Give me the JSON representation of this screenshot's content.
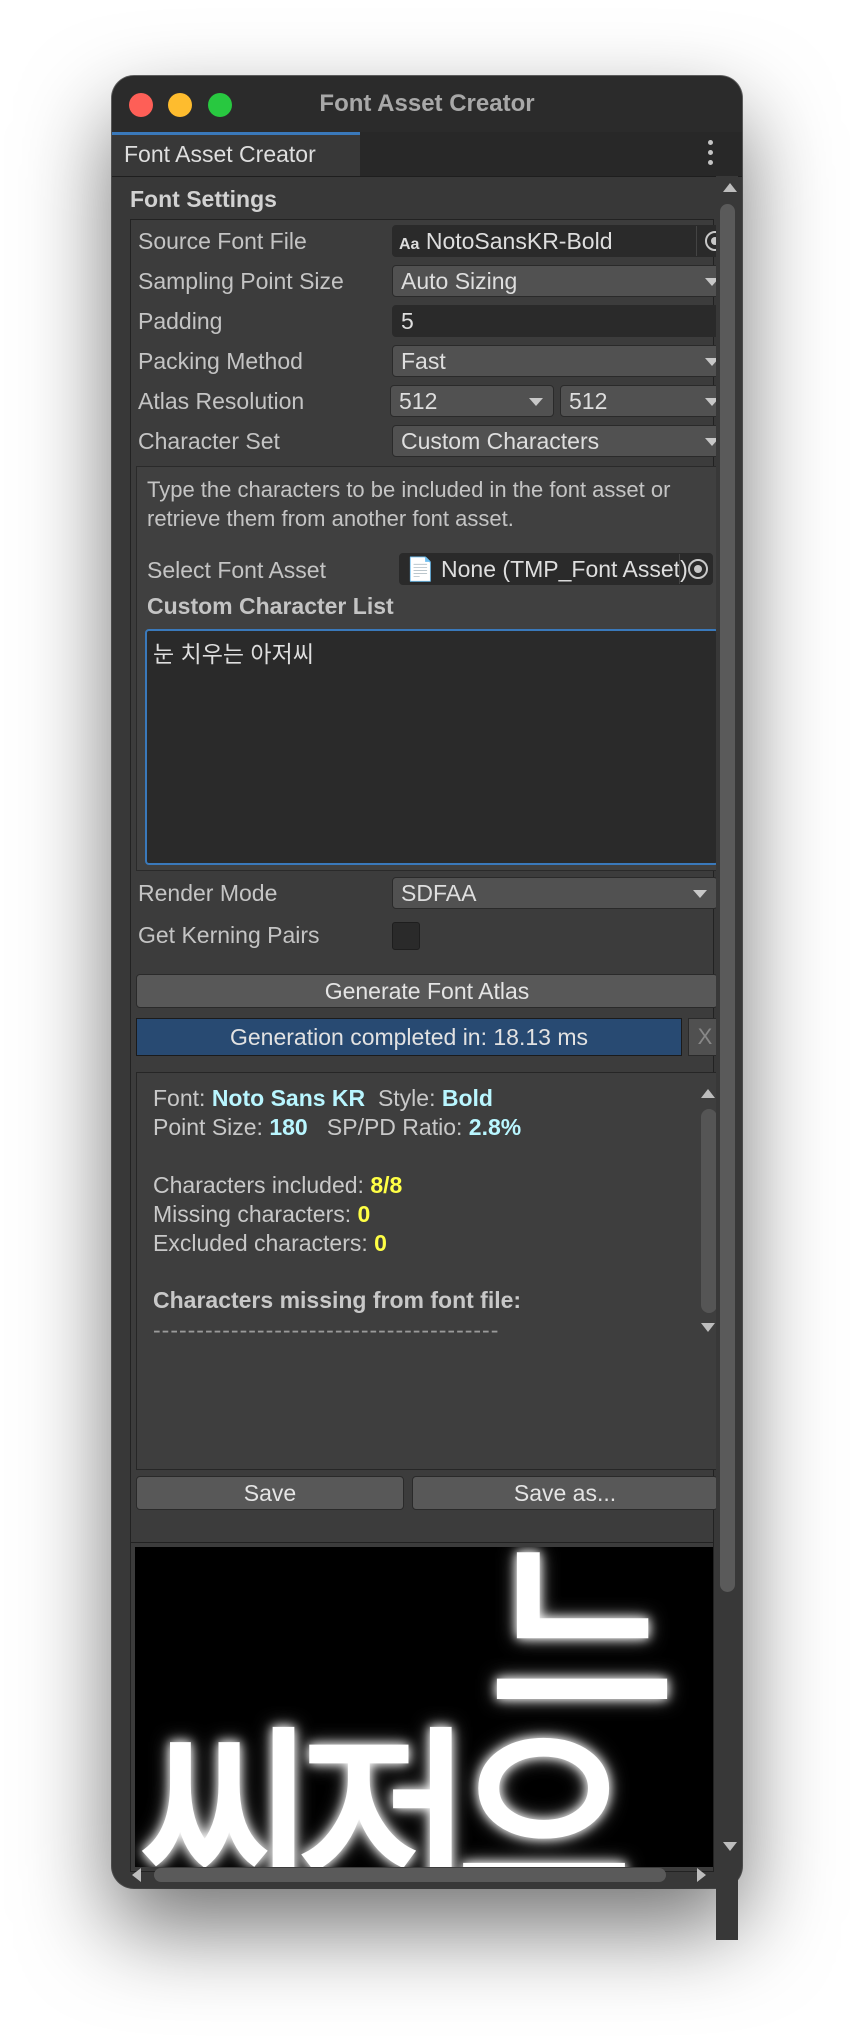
{
  "window": {
    "title": "Font Asset Creator"
  },
  "tab": {
    "label": "Font Asset Creator"
  },
  "font_settings": {
    "section_title": "Font Settings",
    "source_font_file": {
      "label": "Source Font File",
      "icon_text": "Aa",
      "value": "NotoSansKR-Bold"
    },
    "sampling_point_size": {
      "label": "Sampling Point Size",
      "value": "Auto Sizing"
    },
    "padding": {
      "label": "Padding",
      "value": "5"
    },
    "packing_method": {
      "label": "Packing Method",
      "value": "Fast"
    },
    "atlas_resolution": {
      "label": "Atlas Resolution",
      "width": "512",
      "height": "512"
    },
    "character_set": {
      "label": "Character Set",
      "value": "Custom Characters"
    },
    "help_text": "Type the characters to be included in the font asset or retrieve them from another font asset.",
    "select_font_asset": {
      "label": "Select Font Asset",
      "value": "None (TMP_Font Asset)"
    },
    "custom_list": {
      "label": "Custom Character List",
      "value": "눈 치우는 아저씨"
    },
    "render_mode": {
      "label": "Render Mode",
      "value": "SDFAA"
    },
    "kerning": {
      "label": "Get Kerning Pairs",
      "checked": false
    }
  },
  "actions": {
    "generate_label": "Generate Font Atlas",
    "progress_text": "Generation completed in: 18.13 ms",
    "progress_fraction": 1.0,
    "progress_close": "X",
    "save_label": "Save",
    "save_as_label": "Save as..."
  },
  "results": {
    "font_label": "Font:",
    "font_value": "Noto Sans KR",
    "style_label": "Style:",
    "style_value": "Bold",
    "point_size_label": "Point Size:",
    "point_size_value": "180",
    "ratio_label": "SP/PD Ratio:",
    "ratio_value": "2.8%",
    "included_label": "Characters included:",
    "included_value": "8/8",
    "missing_label": "Missing characters:",
    "missing_value": "0",
    "excluded_label": "Excluded characters:",
    "excluded_value": "0",
    "missing_header": "Characters missing from font file:",
    "separator": "----------------------------------------"
  },
  "preview": {
    "top_glyph": "느",
    "row_glyphs": "씨저으"
  },
  "colors": {
    "accent": "#3a79bb",
    "cyan": "#b9f6ff",
    "yellow": "#ffff45",
    "progress": "#284a72"
  }
}
